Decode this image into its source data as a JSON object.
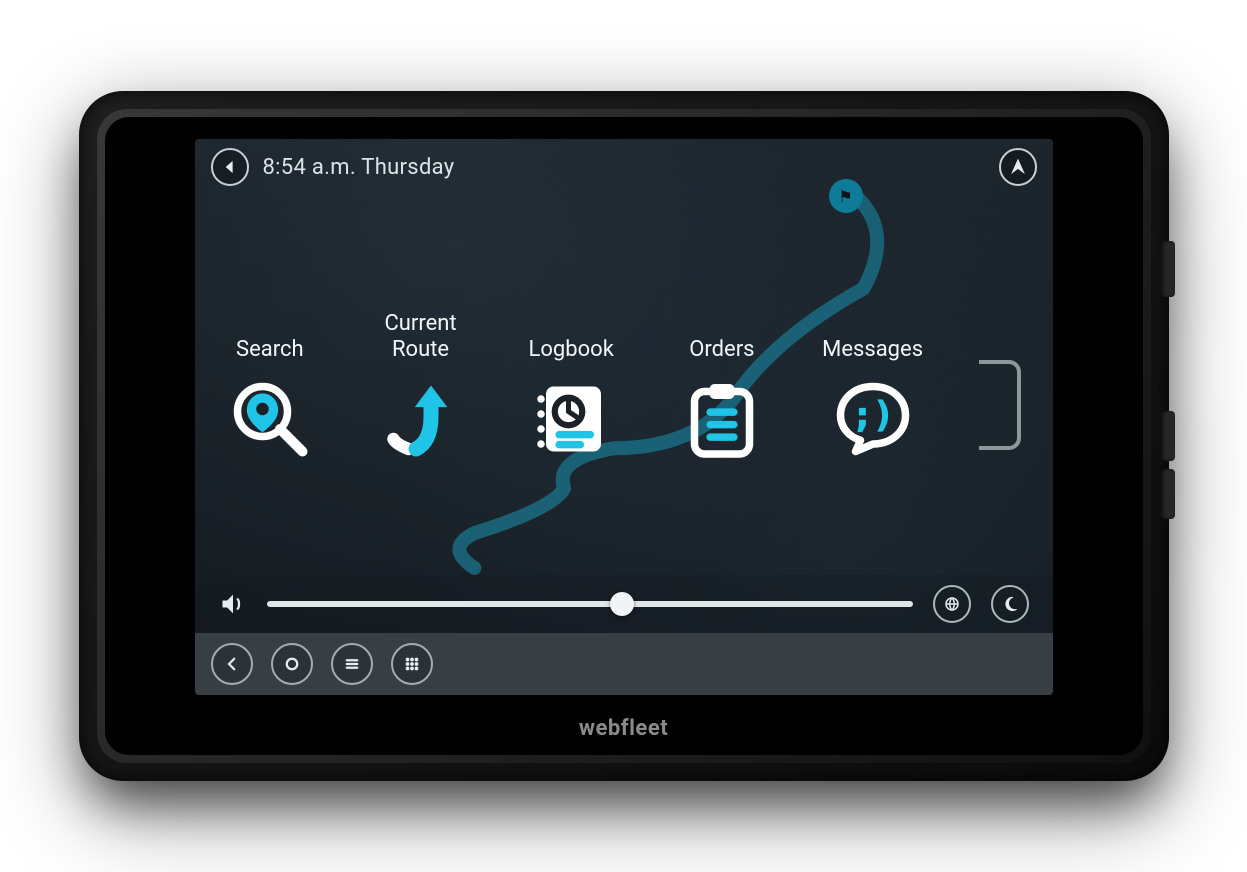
{
  "device": {
    "brand": "webfleet"
  },
  "statusbar": {
    "clock": "8:54 a.m. Thursday"
  },
  "menu": {
    "items": [
      {
        "id": "search",
        "label": "Search"
      },
      {
        "id": "current-route",
        "label": "Current Route"
      },
      {
        "id": "logbook",
        "label": "Logbook"
      },
      {
        "id": "orders",
        "label": "Orders"
      },
      {
        "id": "messages",
        "label": "Messages"
      }
    ]
  },
  "brightness": {
    "value_percent": 55
  },
  "colors": {
    "accent": "#1fc4e6",
    "route": "#1b7a95",
    "panel": "#373f45"
  },
  "icons": {
    "back": "back-icon",
    "recenter": "arrow-pointer-icon",
    "volume": "volume-icon",
    "day-night": "globe-day-icon",
    "night": "moon-icon",
    "nav-back": "chevron-left-icon",
    "nav-home": "circle-icon",
    "nav-menu": "hamburger-icon",
    "nav-apps": "grid-icon"
  }
}
